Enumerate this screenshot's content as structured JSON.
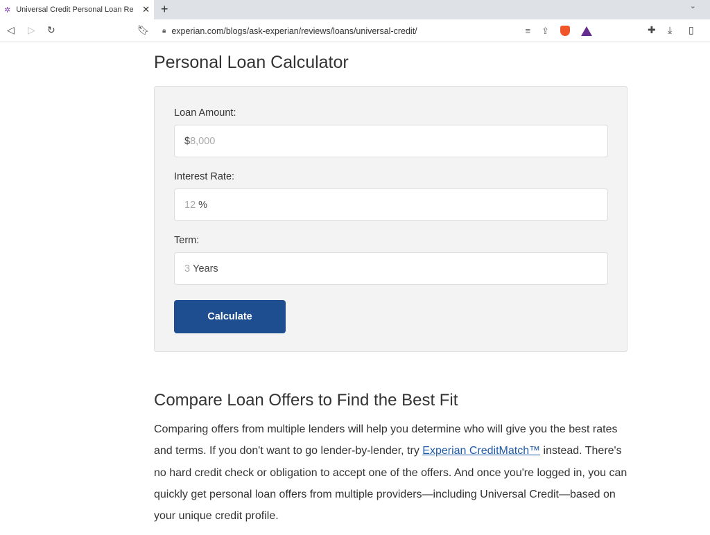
{
  "browser": {
    "tab_title": "Universal Credit Personal Loan Re",
    "url": "experian.com/blogs/ask-experian/reviews/loans/universal-credit/",
    "brave_badge": "8",
    "rewards_badge": "1"
  },
  "page": {
    "title": "Personal Loan Calculator",
    "calculator": {
      "loan_label": "Loan Amount:",
      "loan_prefix": "$",
      "loan_placeholder": "8,000",
      "rate_label": "Interest Rate:",
      "rate_placeholder": "12",
      "rate_suffix": "%",
      "term_label": "Term:",
      "term_placeholder": "3",
      "term_suffix": "Years",
      "button": "Calculate",
      "button_color": "#1e4e8f"
    },
    "section_title": "Compare Loan Offers to Find the Best Fit",
    "para_before": "Comparing offers from multiple lenders will help you determine who will give you the best rates and terms. If you don't want to go lender-by-lender, try ",
    "para_link": "Experian CreditMatch™",
    "para_after": " instead. There's no hard credit check or obligation to accept one of the offers. And once you're logged in, you can quickly get personal loan offers from multiple providers—including Universal Credit—based on your unique credit profile."
  }
}
